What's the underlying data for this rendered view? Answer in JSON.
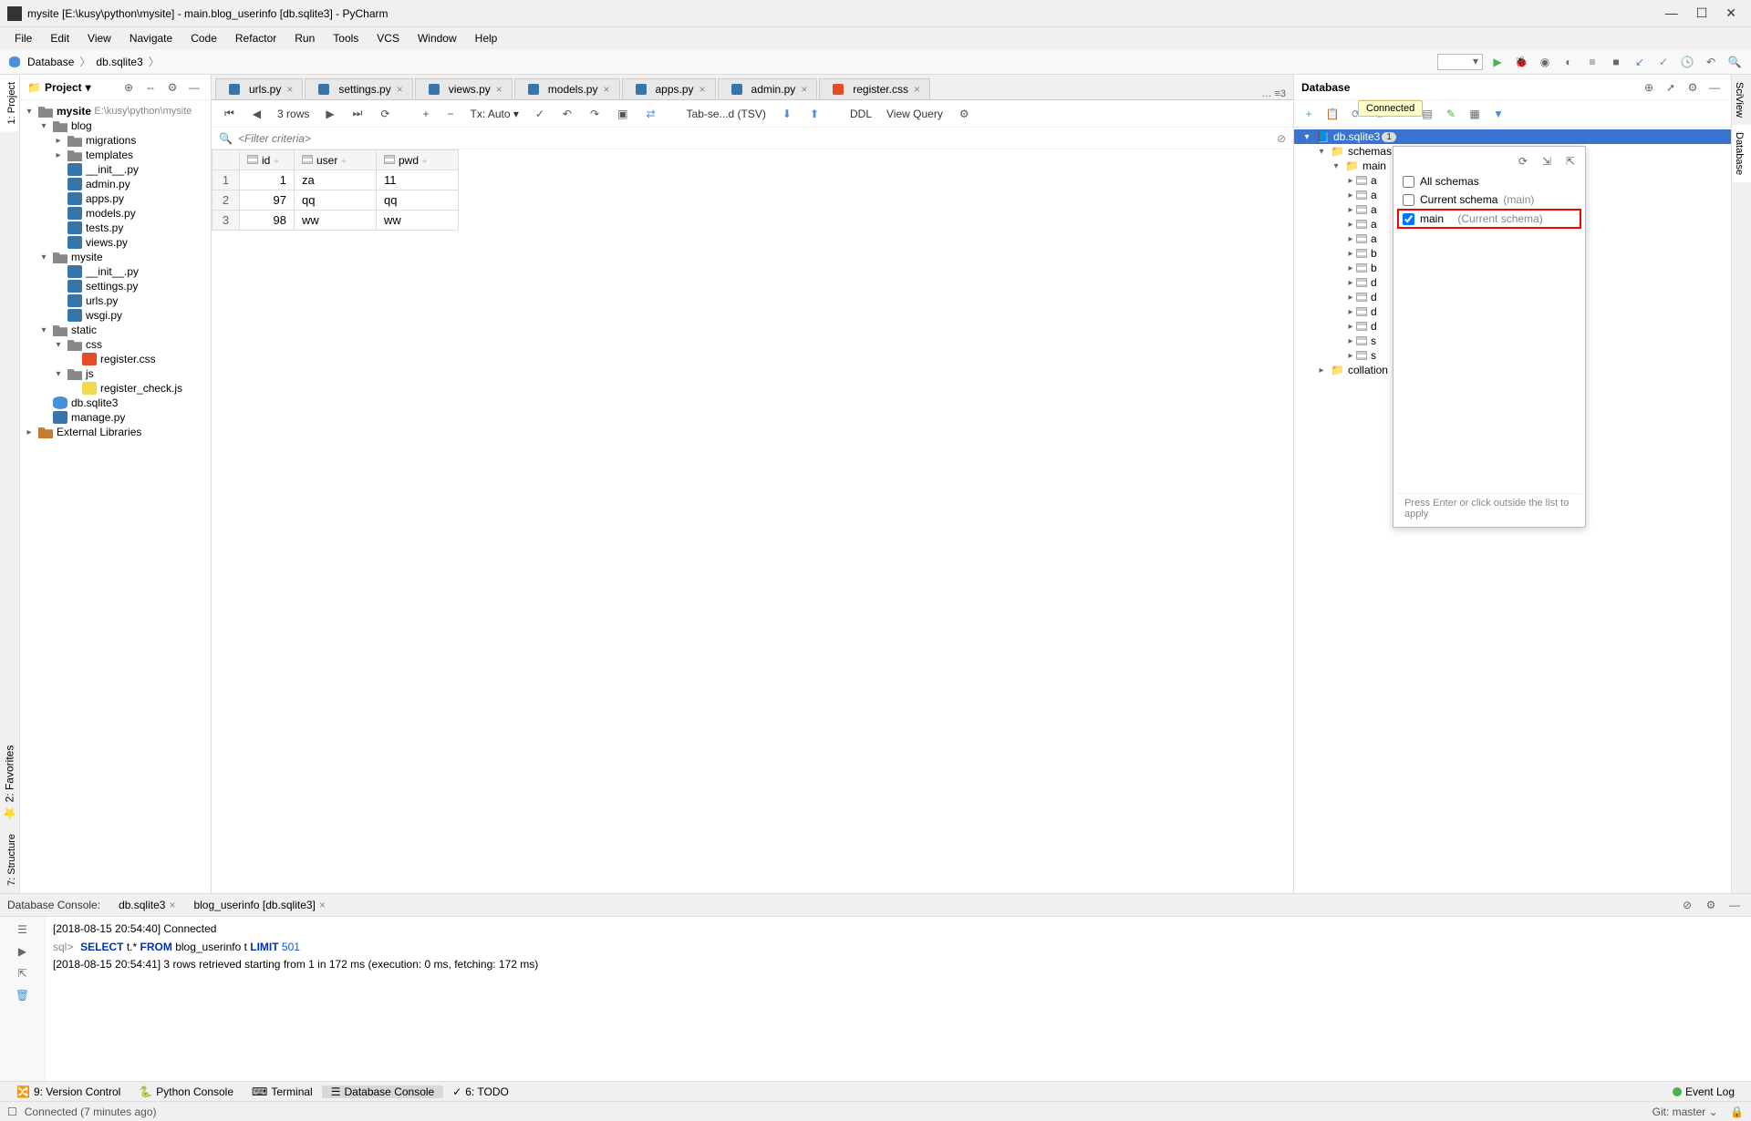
{
  "window_title": "mysite [E:\\kusy\\python\\mysite] - main.blog_userinfo [db.sqlite3] - PyCharm",
  "menus": [
    "File",
    "Edit",
    "View",
    "Navigate",
    "Code",
    "Refactor",
    "Run",
    "Tools",
    "VCS",
    "Window",
    "Help"
  ],
  "breadcrumb": {
    "items": [
      "Database",
      "db.sqlite3"
    ]
  },
  "project": {
    "title": "Project",
    "root": {
      "name": "mysite",
      "path": "E:\\kusy\\python\\mysite"
    },
    "tree": {
      "blog": "blog",
      "migrations": "migrations",
      "templates": "templates",
      "init1": "__init__.py",
      "admin": "admin.py",
      "apps": "apps.py",
      "models": "models.py",
      "tests": "tests.py",
      "views": "views.py",
      "mysite": "mysite",
      "init2": "__init__.py",
      "settings": "settings.py",
      "urls": "urls.py",
      "wsgi": "wsgi.py",
      "static": "static",
      "css": "css",
      "register_css": "register.css",
      "js": "js",
      "register_js": "register_check.js",
      "db": "db.sqlite3",
      "manage": "manage.py",
      "extlib": "External Libraries"
    }
  },
  "editor_tabs": [
    {
      "label": "urls.py"
    },
    {
      "label": "settings.py"
    },
    {
      "label": "views.py"
    },
    {
      "label": "models.py"
    },
    {
      "label": "apps.py"
    },
    {
      "label": "admin.py"
    },
    {
      "label": "register.css"
    }
  ],
  "editor_tabs_right": "… ≡3",
  "data_toolbar": {
    "rows": "3 rows",
    "tx": "Tx: Auto",
    "tab_separated": "Tab-se...d (TSV)",
    "ddl": "DDL",
    "view_query": "View Query"
  },
  "filter_placeholder": "<Filter criteria>",
  "grid": {
    "cols": [
      "id",
      "user",
      "pwd"
    ],
    "rows": [
      {
        "n": "1",
        "id": "1",
        "user": "za",
        "pwd": "11"
      },
      {
        "n": "2",
        "id": "97",
        "user": "qq",
        "pwd": "qq"
      },
      {
        "n": "3",
        "id": "98",
        "user": "ww",
        "pwd": "ww"
      }
    ]
  },
  "database_panel": {
    "title": "Database",
    "tooltip": "Connected",
    "source": "db.sqlite3",
    "source_badge": "1",
    "schemas": "schemas",
    "main": "main",
    "tables": [
      "a",
      "a",
      "a",
      "a",
      "a",
      "b",
      "b",
      "d",
      "d",
      "d",
      "d",
      "s",
      "s"
    ],
    "collations": "collation",
    "popup": {
      "all_schemas": "All schemas",
      "current_schema": "Current schema",
      "current_schema_hint": "(main)",
      "main": "main",
      "main_hint": "(Current schema)",
      "footer": "Press Enter or click outside the list to apply"
    }
  },
  "console": {
    "title": "Database Console:",
    "tabs": [
      "db.sqlite3",
      "blog_userinfo [db.sqlite3]"
    ],
    "line1": "[2018-08-15 20:54:40] Connected",
    "sql_prompt": "sql>",
    "sql_line_parts": [
      "SELECT",
      " t.* ",
      "FROM",
      " blog_userinfo t ",
      "LIMIT",
      " 501"
    ],
    "line3": "[2018-08-15 20:54:41] 3 rows retrieved starting from 1 in 172 ms (execution: 0 ms, fetching: 172 ms)"
  },
  "bottom_tabs": {
    "version_control": "9: Version Control",
    "python_console": "Python Console",
    "terminal": "Terminal",
    "database_console": "Database Console",
    "todo": "6: TODO",
    "event_log": "Event Log"
  },
  "status": {
    "left": "Connected (7 minutes ago)",
    "right": "Git: master"
  },
  "side_tabs_left": [
    "1: Project",
    "2: Favorites",
    "7: Structure"
  ],
  "side_tabs_right": [
    "SciView",
    "Database"
  ]
}
